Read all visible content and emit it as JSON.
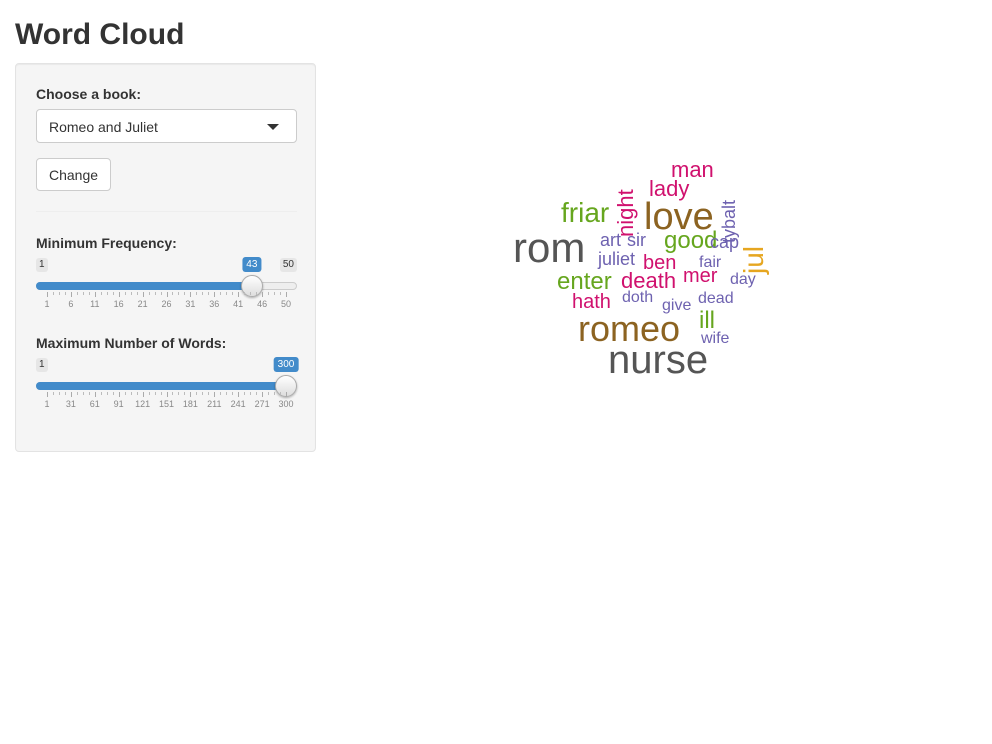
{
  "app": {
    "title": "Word Cloud"
  },
  "sidebar": {
    "book_label": "Choose a book:",
    "book_selected": "Romeo and Juliet",
    "change_button": "Change",
    "min_freq": {
      "label": "Minimum Frequency:",
      "min": 1,
      "max": 50,
      "value": 43,
      "min_text": "1",
      "max_text": "50",
      "value_text": "43",
      "tick_labels": [
        "1",
        "6",
        "11",
        "16",
        "21",
        "26",
        "31",
        "36",
        "41",
        "46",
        "50"
      ]
    },
    "max_words": {
      "label": "Maximum Number of Words:",
      "min": 1,
      "max": 300,
      "value": 300,
      "min_text": "1",
      "value_text": "300",
      "tick_labels": [
        "1",
        "31",
        "61",
        "91",
        "121",
        "151",
        "181",
        "211",
        "241",
        "271",
        "300"
      ]
    }
  },
  "colors": {
    "accent": "#428bca",
    "gray": "#555555",
    "brown": "#8c6321",
    "green": "#66a61e",
    "magenta": "#d0116e",
    "purple": "#6e62b0",
    "gold": "#e6a620"
  },
  "word_cloud": [
    {
      "text": "nurse",
      "color": "#555555"
    },
    {
      "text": "rom",
      "color": "#555555"
    },
    {
      "text": "romeo",
      "color": "#8c6321"
    },
    {
      "text": "love",
      "color": "#8c6321"
    },
    {
      "text": "jul",
      "color": "#e6a620",
      "vertical": true
    },
    {
      "text": "friar",
      "color": "#66a61e"
    },
    {
      "text": "enter",
      "color": "#66a61e"
    },
    {
      "text": "good",
      "color": "#66a61e"
    },
    {
      "text": "ill",
      "color": "#66a61e"
    },
    {
      "text": "man",
      "color": "#d0116e"
    },
    {
      "text": "lady",
      "color": "#d0116e"
    },
    {
      "text": "night",
      "color": "#d0116e",
      "vertical": true
    },
    {
      "text": "death",
      "color": "#d0116e"
    },
    {
      "text": "hath",
      "color": "#d0116e"
    },
    {
      "text": "ben",
      "color": "#d0116e"
    },
    {
      "text": "mer",
      "color": "#d0116e"
    },
    {
      "text": "tybalt",
      "color": "#6e62b0",
      "vertical": true
    },
    {
      "text": "art",
      "color": "#6e62b0"
    },
    {
      "text": "sir",
      "color": "#6e62b0"
    },
    {
      "text": "cap",
      "color": "#6e62b0"
    },
    {
      "text": "juliet",
      "color": "#6e62b0"
    },
    {
      "text": "fair",
      "color": "#6e62b0"
    },
    {
      "text": "day",
      "color": "#6e62b0"
    },
    {
      "text": "doth",
      "color": "#6e62b0"
    },
    {
      "text": "give",
      "color": "#6e62b0"
    },
    {
      "text": "dead",
      "color": "#6e62b0"
    },
    {
      "text": "wife",
      "color": "#6e62b0"
    }
  ]
}
